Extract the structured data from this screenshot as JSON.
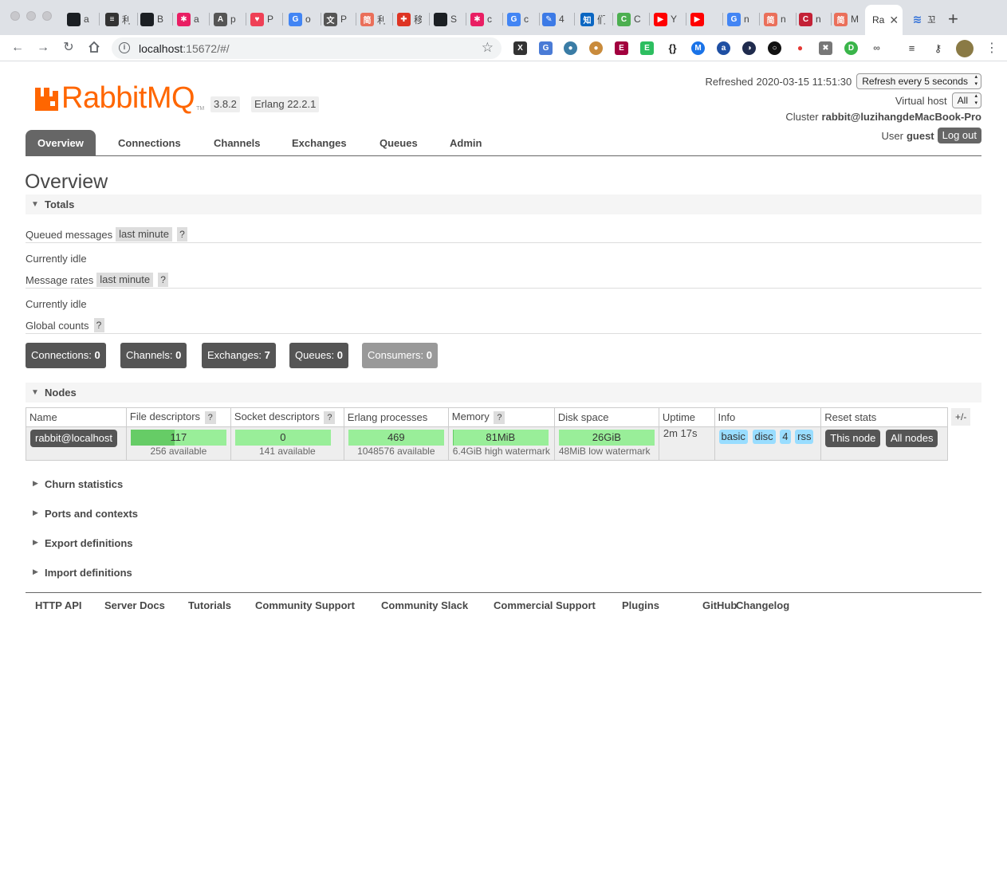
{
  "browser": {
    "tabs": [
      {
        "icon": "github-icon",
        "glyph": "",
        "color": "#1b1f23",
        "text": "a"
      },
      {
        "icon": "doc-icon",
        "glyph": "≡",
        "color": "#333333",
        "text": "利"
      },
      {
        "icon": "github-icon",
        "glyph": "",
        "color": "#1b1f23",
        "text": "B"
      },
      {
        "icon": "asterisk-icon",
        "glyph": "✱",
        "color": "#e91e63",
        "text": "a"
      },
      {
        "icon": "translate-icon",
        "glyph": "A",
        "color": "#555555",
        "text": "p"
      },
      {
        "icon": "pocket-icon",
        "glyph": "♥",
        "color": "#ef4056",
        "text": "P"
      },
      {
        "icon": "google-icon",
        "glyph": "G",
        "color": "#4285f4",
        "text": "o"
      },
      {
        "icon": "translate-icon",
        "glyph": "文",
        "color": "#555555",
        "text": "P"
      },
      {
        "icon": "jianshu-icon",
        "glyph": "简",
        "color": "#ea6f5a",
        "text": "利"
      },
      {
        "icon": "scala-icon",
        "glyph": "✚",
        "color": "#de3423",
        "text": "移"
      },
      {
        "icon": "github-icon",
        "glyph": "",
        "color": "#1b1f23",
        "text": "S"
      },
      {
        "icon": "asterisk-icon",
        "glyph": "✱",
        "color": "#e91e63",
        "text": "c"
      },
      {
        "icon": "google-icon",
        "glyph": "G",
        "color": "#4285f4",
        "text": "c"
      },
      {
        "icon": "feather-icon",
        "glyph": "✎",
        "color": "#3c7ae6",
        "text": "4"
      },
      {
        "icon": "zhihu-icon",
        "glyph": "知",
        "color": "#0a66c2",
        "text": "们"
      },
      {
        "icon": "c-icon",
        "glyph": "C",
        "color": "#4caf50",
        "text": "C"
      },
      {
        "icon": "youtube-icon",
        "glyph": "▶",
        "color": "#ff0000",
        "text": "Y"
      },
      {
        "icon": "youtube-icon",
        "glyph": "▶",
        "color": "#ff0000",
        "text": ""
      },
      {
        "icon": "google-icon",
        "glyph": "G",
        "color": "#4285f4",
        "text": "n"
      },
      {
        "icon": "jianshu-icon",
        "glyph": "简",
        "color": "#ea6f5a",
        "text": "n"
      },
      {
        "icon": "csdn-icon",
        "glyph": "C",
        "color": "#c32136",
        "text": "n"
      },
      {
        "icon": "jianshu-icon",
        "glyph": "简",
        "color": "#ea6f5a",
        "text": "M"
      }
    ],
    "active_tab": {
      "text": "Ra",
      "close": "✕"
    },
    "after_tab": {
      "icon": "layers-icon",
      "glyph": "≋",
      "color": "#2f6fd8",
      "text": "꼬"
    },
    "new_tab": "+",
    "url_host": "localhost",
    "url_rest": ":15672/#/"
  },
  "header": {
    "logo_text": "RabbitMQ",
    "logo_tm": "TM",
    "version": "3.8.2",
    "erlang": "Erlang 22.2.1",
    "refreshed_label": "Refreshed",
    "refreshed_time": "2020-03-15 11:51:30",
    "refresh_select": "Refresh every 5 seconds",
    "vhost_label": "Virtual host",
    "vhost_select": "All",
    "cluster_label": "Cluster",
    "cluster_name": "rabbit@luzihangdeMacBook-Pro",
    "user_label": "User",
    "user_name": "guest",
    "logout": "Log out"
  },
  "nav": {
    "tabs": [
      "Overview",
      "Connections",
      "Channels",
      "Exchanges",
      "Queues",
      "Admin"
    ],
    "active": "Overview"
  },
  "overview": {
    "title": "Overview",
    "totals_heading": "Totals",
    "queued_label": "Queued messages",
    "queued_range": "last minute",
    "help": "?",
    "idle1": "Currently idle",
    "rates_label": "Message rates",
    "rates_range": "last minute",
    "idle2": "Currently idle",
    "global_label": "Global counts",
    "counts": [
      {
        "label": "Connections:",
        "value": "0",
        "dim": false
      },
      {
        "label": "Channels:",
        "value": "0",
        "dim": false
      },
      {
        "label": "Exchanges:",
        "value": "7",
        "dim": false
      },
      {
        "label": "Queues:",
        "value": "0",
        "dim": false
      },
      {
        "label": "Consumers:",
        "value": "0",
        "dim": true
      }
    ]
  },
  "nodes": {
    "heading": "Nodes",
    "plusminus": "+/-",
    "columns": [
      "Name",
      "File descriptors",
      "Socket descriptors",
      "Erlang processes",
      "Memory",
      "Disk space",
      "Uptime",
      "Info",
      "Reset stats"
    ],
    "row": {
      "name": "rabbit@localhost",
      "fd_value": "117",
      "fd_fraction": 0.457,
      "fd_sub": "256 available",
      "sock_value": "0",
      "sock_fraction": 0,
      "sock_sub": "141 available",
      "proc_value": "469",
      "proc_fraction": 0.0004,
      "proc_sub": "1048576 available",
      "mem_value": "81MiB",
      "mem_fraction": 0.012,
      "mem_sub": "6.4GiB high watermark",
      "disk_value": "26GiB",
      "disk_fraction": 0,
      "disk_sub": "48MiB low watermark",
      "uptime": "2m 17s",
      "info_tags": [
        "basic",
        "disc",
        "4",
        "rss"
      ],
      "reset_this": "This node",
      "reset_all": "All nodes"
    }
  },
  "sections": [
    "Churn statistics",
    "Ports and contexts",
    "Export definitions",
    "Import definitions"
  ],
  "footer": [
    "HTTP API",
    "Server Docs",
    "Tutorials",
    "Community Support",
    "Community Slack",
    "Commercial Support",
    "Plugins",
    "GitHub",
    "Changelog"
  ],
  "colors": {
    "brand": "#ff6600",
    "tab_active_bg": "#666666",
    "bar_bg": "#99ee99",
    "bar_fill": "#66cc66",
    "info_tag": "#99ddff"
  }
}
